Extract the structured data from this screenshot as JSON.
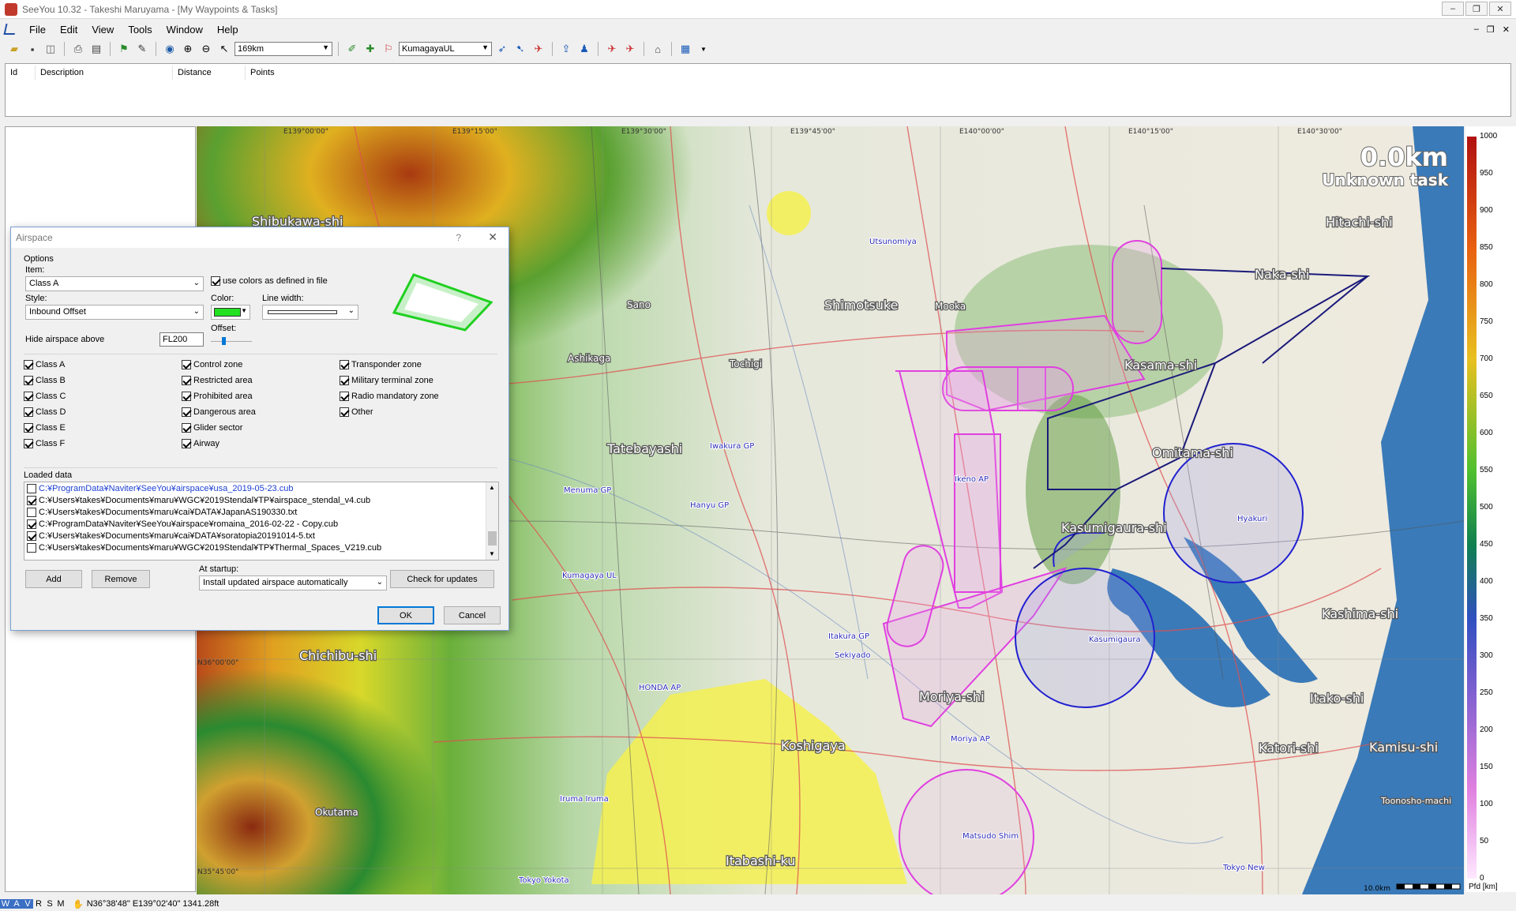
{
  "window": {
    "title": "SeeYou 10.32 - Takeshi Maruyama - [My Waypoints & Tasks]",
    "controls": [
      "–",
      "❐",
      "✕"
    ],
    "mdi_controls": [
      "–",
      "❐",
      "✕"
    ]
  },
  "menu": [
    "File",
    "Edit",
    "View",
    "Tools",
    "Window",
    "Help"
  ],
  "toolbar": {
    "distance_value": "169km",
    "waypoint_value": "KumagayaUL"
  },
  "tasklist": {
    "columns": [
      "Id",
      "Description",
      "Distance",
      "Points"
    ]
  },
  "map": {
    "distance_display": "0.0km",
    "task_label": "Unknown task",
    "colors": {
      "airspace_magenta": "#e040e0",
      "airspace_blue": "#2020d0",
      "task_line": "#1a1a7a",
      "sea": "#3a7ab8"
    },
    "grid_labels": [
      "E139°00'00\"",
      "E139°15'00\"",
      "E139°30'00\"",
      "E139°45'00\"",
      "E140°00'00\"",
      "E140°15'00\"",
      "E140°30'00\""
    ],
    "lat_labels": [
      "N36°00'00\"",
      "N35°45'00\""
    ],
    "cities": [
      "Shibukawa-shi",
      "Hitachi-shi",
      "Naka-shi",
      "Sano",
      "Shimotsuke",
      "Mooka",
      "Ashikaga",
      "Tochigi",
      "Kasama-shi",
      "Tatebayashi",
      "Omitama-shi",
      "Kasumigaura-shi",
      "Kashima-shi",
      "Chichibu-shi",
      "Moriya-shi",
      "Itako-shi",
      "Koshigaya",
      "Katori-shi",
      "Kamisu-shi",
      "Okutama",
      "Itabashi-ku",
      "Toonosho-machi"
    ],
    "airports": [
      "Utsunomiya",
      "Iwakura GP",
      "Menuma GP",
      "Hanyu GP",
      "Ikeno AP",
      "Kumagaya UL",
      "Itakura GP",
      "Sekiyado",
      "HONDA AP",
      "Moriya AP",
      "Iruma Iruma",
      "Matsudo Shim",
      "Tokyo Yokota",
      "Tokyo New",
      "Kasumigaura",
      "Hyakuri"
    ]
  },
  "scale": {
    "labels": [
      "1000",
      "950",
      "900",
      "850",
      "800",
      "750",
      "700",
      "650",
      "600",
      "550",
      "500",
      "450",
      "400",
      "350",
      "300",
      "250",
      "200",
      "150",
      "100",
      "50",
      "0"
    ],
    "unit": "Pfd [km]",
    "scale_text": "10.0km"
  },
  "status": {
    "modes": [
      "W",
      "A",
      "V",
      "R",
      "S",
      "M"
    ],
    "coords": "N36°38'48\"  E139°02'40\"  1341.28ft"
  },
  "dialog": {
    "title": "Airspace",
    "help": "?",
    "close": "✕",
    "options_label": "Options",
    "item_label": "Item:",
    "item_value": "Class A",
    "use_colors_label": "use colors as defined in file",
    "style_label": "Style:",
    "style_value": "Inbound Offset",
    "color_label": "Color:",
    "line_width_label": "Line width:",
    "offset_label": "Offset:",
    "hide_label": "Hide airspace above",
    "hide_value": "FL200",
    "classes_col1": [
      "Class A",
      "Class B",
      "Class C",
      "Class D",
      "Class E",
      "Class F"
    ],
    "classes_col2": [
      "Control zone",
      "Restricted area",
      "Prohibited area",
      "Dangerous area",
      "Glider sector",
      "Airway"
    ],
    "classes_col3": [
      "Transponder zone",
      "Military terminal zone",
      "Radio mandatory zone",
      "Other"
    ],
    "loaded_label": "Loaded data",
    "loaded_files": [
      {
        "path": "C:¥ProgramData¥Naviter¥SeeYou¥airspace¥usa_2019-05-23.cub",
        "checked": false,
        "selected": true
      },
      {
        "path": "C:¥Users¥takes¥Documents¥maru¥WGC¥2019Stendal¥TP¥airspace_stendal_v4.cub",
        "checked": true,
        "selected": false
      },
      {
        "path": "C:¥Users¥takes¥Documents¥maru¥cai¥DATA¥JapanAS190330.txt",
        "checked": false,
        "selected": false
      },
      {
        "path": "C:¥ProgramData¥Naviter¥SeeYou¥airspace¥romaina_2016-02-22 - Copy.cub",
        "checked": true,
        "selected": false
      },
      {
        "path": "C:¥Users¥takes¥Documents¥maru¥cai¥DATA¥soratopia20191014-5.txt",
        "checked": true,
        "selected": false
      },
      {
        "path": "C:¥Users¥takes¥Documents¥maru¥WGC¥2019Stendal¥TP¥Thermal_Spaces_V219.cub",
        "checked": false,
        "selected": false
      }
    ],
    "add_label": "Add",
    "remove_label": "Remove",
    "startup_label": "At startup:",
    "startup_value": "Install updated airspace automatically",
    "check_updates_label": "Check for updates",
    "ok_label": "OK",
    "cancel_label": "Cancel",
    "selected_color": "#22e022"
  }
}
